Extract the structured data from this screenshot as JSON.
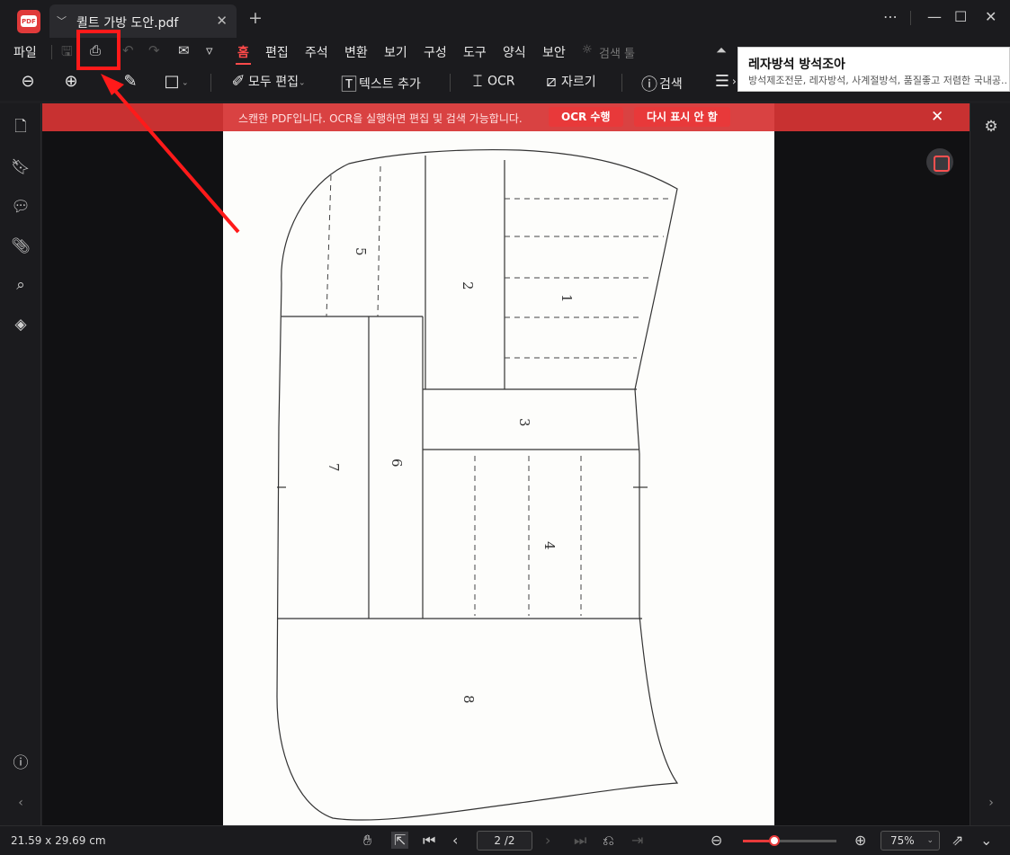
{
  "app": {
    "tab_title": "퀼트 가방 도안.pdf",
    "accent": "#e83a3a"
  },
  "menu": {
    "file": "파일",
    "items": [
      "홈",
      "편집",
      "주석",
      "변환",
      "보기",
      "구성",
      "도구",
      "양식",
      "보안"
    ],
    "active": "홈",
    "search_hint": "검색 툴"
  },
  "toolbar": {
    "edit_all": "모두 편집",
    "add_text": "텍스트 추가",
    "ocr": "OCR",
    "crop": "자르기",
    "search": "검색"
  },
  "tooltip": {
    "title": "레자방석 방석조아",
    "subtitle": "방석제조전문, 레자방석, 사계절방석, 품질좋고 저렴한 국내공..."
  },
  "ocr_banner": {
    "message": "스캔한 PDF입니다. OCR을 실행하면 편집 및 검색 가능합니다.",
    "run_button": "OCR 수행",
    "dismiss_button": "다시 표시 안 함"
  },
  "pattern_labels": [
    "5",
    "2",
    "1",
    "3",
    "7",
    "6",
    "4",
    "8"
  ],
  "status": {
    "page_size": "21.59 x 29.69 cm",
    "page_indicator": "2 /2",
    "zoom": "75%",
    "zoom_level": 0.34
  },
  "icons": {
    "print": "print-icon",
    "zoom_out": "zoom-out-icon",
    "zoom_in": "zoom-in-icon",
    "highlighter": "highlighter-icon",
    "rectangle": "rectangle-icon"
  }
}
